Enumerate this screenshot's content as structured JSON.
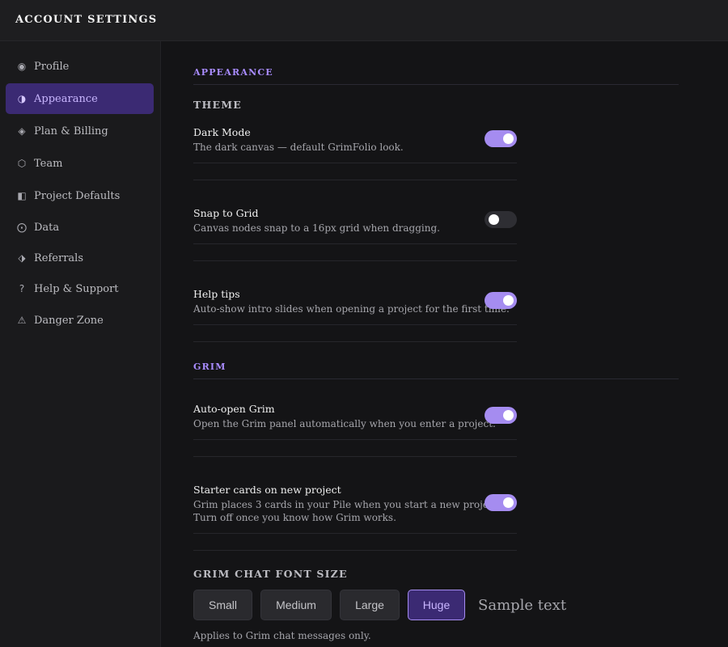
{
  "header": {
    "title": "ACCOUNT SETTINGS"
  },
  "sidebar": {
    "items": [
      {
        "label": "Profile",
        "icon": "◉",
        "icon_name": "profile-icon",
        "active": false
      },
      {
        "label": "Appearance",
        "icon": "◑",
        "icon_name": "contrast-icon",
        "active": true
      },
      {
        "label": "Plan & Billing",
        "icon": "◈",
        "icon_name": "diamond-icon",
        "active": false
      },
      {
        "label": "Team",
        "icon": "⬡",
        "icon_name": "hexagon-icon",
        "active": false
      },
      {
        "label": "Project Defaults",
        "icon": "◧",
        "icon_name": "square-half-icon",
        "active": false
      },
      {
        "label": "Data",
        "icon": "⨀",
        "icon_name": "circle-dot-icon",
        "active": false
      },
      {
        "label": "Referrals",
        "icon": "⬗",
        "icon_name": "gift-diamond-icon",
        "active": false
      },
      {
        "label": "Help & Support",
        "icon": "?",
        "icon_name": "question-icon",
        "active": false
      },
      {
        "label": "Danger Zone",
        "icon": "⚠",
        "icon_name": "warning-icon",
        "active": false
      }
    ]
  },
  "appearance": {
    "section_label": "APPEARANCE",
    "theme_heading": "THEME",
    "settings": [
      {
        "name": "Dark Mode",
        "desc": "The dark canvas — default GrimFolio look.",
        "on": true
      },
      {
        "name": "Snap to Grid",
        "desc": "Canvas nodes snap to a 16px grid when dragging.",
        "on": false
      },
      {
        "name": "Help tips",
        "desc": "Auto-show intro slides when opening a project for the first time.",
        "on": true
      }
    ]
  },
  "grim": {
    "section_label": "GRIM",
    "settings": [
      {
        "name": "Auto-open Grim",
        "desc": "Open the Grim panel automatically when you enter a project.",
        "on": true
      },
      {
        "name": "Starter cards on new project",
        "desc": "Grim places 3 cards in your Pile when you start a new project.",
        "desc2": "Turn off once you know how Grim works.",
        "on": true
      }
    ],
    "font_size": {
      "heading": "GRIM CHAT FONT SIZE",
      "options": [
        "Small",
        "Medium",
        "Large",
        "Huge"
      ],
      "selected": "Huge",
      "sample": "Sample text",
      "footnote": "Applies to Grim chat messages only."
    }
  },
  "colors": {
    "accent": "#a58cf0",
    "active_bg": "#3b2a73",
    "background": "#141416"
  }
}
